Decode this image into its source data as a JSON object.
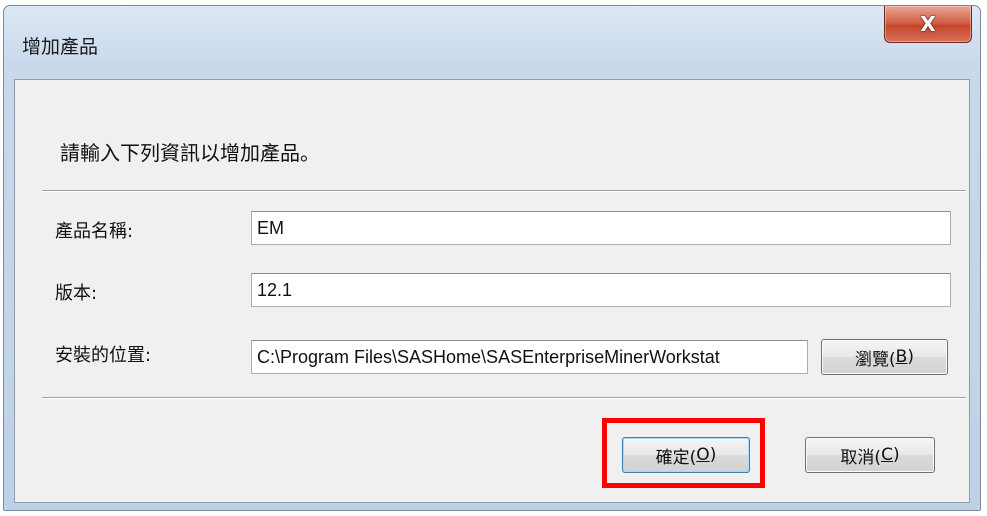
{
  "window": {
    "title": "增加產品",
    "close_glyph": "X"
  },
  "dialog": {
    "prompt": "請輸入下列資訊以增加產品。",
    "fields": {
      "product_name": {
        "label": "產品名稱:",
        "value": "EM"
      },
      "version": {
        "label": "版本:",
        "value": "12.1"
      },
      "install_location": {
        "label": "安裝的位置:",
        "value": "C:\\Program Files\\SASHome\\SASEnterpriseMinerWorkstat"
      }
    },
    "buttons": {
      "browse": {
        "text": "瀏覽(",
        "mnemonic": "B",
        "close": ")"
      },
      "ok": {
        "text": "確定(",
        "mnemonic": "O",
        "close": ")"
      },
      "cancel": {
        "text": "取消(",
        "mnemonic": "C",
        "close": ")"
      }
    }
  },
  "colors": {
    "highlight": "#ff0000",
    "close_button": "#c7462c"
  }
}
